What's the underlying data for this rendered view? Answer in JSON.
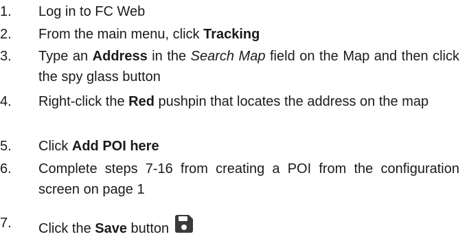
{
  "steps": [
    {
      "num": "1.",
      "parts": [
        {
          "t": "Log in to FC Web"
        }
      ]
    },
    {
      "num": "2.",
      "parts": [
        {
          "t": "From the main menu, click "
        },
        {
          "t": "Tracking",
          "b": true
        }
      ]
    },
    {
      "num": "3.",
      "parts": [
        {
          "t": "Type an "
        },
        {
          "t": "Address",
          "b": true
        },
        {
          "t": " in the "
        },
        {
          "t": "Search Map",
          "i": true
        },
        {
          "t": " field on the Map and then click the spy glass button"
        }
      ]
    },
    {
      "num": "4.",
      "parts": [
        {
          "t": "Right-click the "
        },
        {
          "t": "Red",
          "b": true
        },
        {
          "t": " pushpin that locates the address on the map"
        }
      ]
    },
    {
      "num": "5.",
      "parts": [
        {
          "t": "Click "
        },
        {
          "t": "Add POI here",
          "b": true
        }
      ]
    },
    {
      "num": "6.",
      "parts": [
        {
          "t": "Complete steps 7-16 from creating a POI from the configuration screen on page 1"
        }
      ]
    },
    {
      "num": "7.",
      "parts": [
        {
          "t": "Click the "
        },
        {
          "t": "Save",
          "b": true
        },
        {
          "t": " button"
        }
      ]
    }
  ],
  "icons": {
    "save": "floppy-disk-save-icon"
  },
  "colors": {
    "text": "#1a1a1a",
    "icon": "#3a3a3a"
  }
}
